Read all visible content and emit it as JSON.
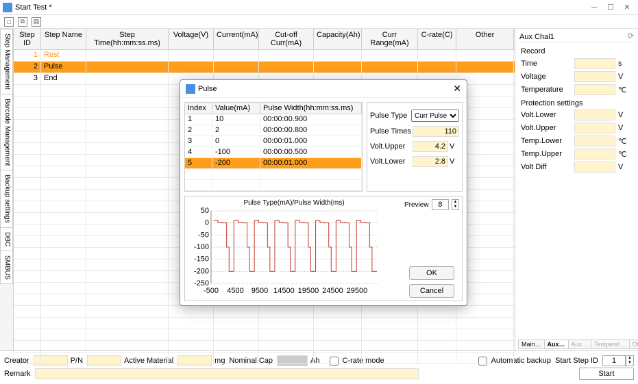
{
  "window": {
    "title": "Start Test *"
  },
  "sideTabs": [
    "Step Management",
    "Barcode Management",
    "Backup settings",
    "DBC",
    "SMBUS"
  ],
  "grid": {
    "headers": [
      "Step ID",
      "Step Name",
      "Step Time(hh:mm:ss.ms)",
      "Voltage(V)",
      "Current(mA)",
      "Cut-off Curr(mA)",
      "Capacity(Ah)",
      "Curr Range(mA)",
      "C-rate(C)",
      "Other"
    ],
    "rows": [
      {
        "id": "1",
        "name": "Rest",
        "class": "rest"
      },
      {
        "id": "2",
        "name": "Pulse",
        "class": "sel"
      },
      {
        "id": "3",
        "name": "End",
        "class": ""
      }
    ]
  },
  "aux": {
    "title": "Aux Chal1",
    "sections": {
      "record_title": "Record",
      "record": [
        {
          "lbl": "Time",
          "unit": "s"
        },
        {
          "lbl": "Voltage",
          "unit": "V"
        },
        {
          "lbl": "Temperature",
          "unit": "℃"
        }
      ],
      "prot_title": "Protection settings",
      "prot": [
        {
          "lbl": "Volt.Lower",
          "unit": "V"
        },
        {
          "lbl": "Volt.Upper",
          "unit": "V"
        },
        {
          "lbl": "Temp.Lower",
          "unit": "℃"
        },
        {
          "lbl": "Temp.Upper",
          "unit": "℃"
        },
        {
          "lbl": "Volt Diff",
          "unit": "V"
        }
      ]
    },
    "subtabs": [
      "Main…",
      "Aux…",
      "Aux…",
      "Temperat…",
      "Other"
    ]
  },
  "bottom": {
    "labels": {
      "creator": "Creator",
      "pn": "P/N",
      "active": "Active Material",
      "mg": "mg",
      "nominal": "Nominal Cap",
      "ah": "Ah",
      "crate": "C-rate mode",
      "auto": "Automatic backup",
      "startid": "Start Step ID",
      "remark": "Remark",
      "start": "Start"
    },
    "startStepId": "1"
  },
  "modal": {
    "title": "Pulse",
    "tableHeaders": [
      "Index",
      "Value(mA)",
      "Pulse Width(hh:mm:ss.ms)"
    ],
    "tableRows": [
      {
        "idx": "1",
        "val": "10",
        "pw": "00:00:00.900"
      },
      {
        "idx": "2",
        "val": "2",
        "pw": "00:00:00.800"
      },
      {
        "idx": "3",
        "val": "0",
        "pw": "00:00:01.000"
      },
      {
        "idx": "4",
        "val": "-100",
        "pw": "00:00:00.500"
      },
      {
        "idx": "5",
        "val": "-200",
        "pw": "00:00:01.000",
        "sel": true
      }
    ],
    "side": {
      "pulseType_lbl": "Pulse Type",
      "pulseType_val": "Curr Pulse",
      "times_lbl": "Pulse Times",
      "times_val": "110",
      "upper_lbl": "Volt.Upper",
      "upper_val": "4.2",
      "upper_unit": "V",
      "lower_lbl": "Volt.Lower",
      "lower_val": "2.8",
      "lower_unit": "V"
    },
    "chartTitle": "Pulse Type(mA)/Pulse Width(ms)",
    "preview_lbl": "Preview",
    "preview_val": "8",
    "ok": "OK",
    "cancel": "Cancel"
  },
  "chart_data": {
    "type": "line",
    "title": "Pulse Type(mA)/Pulse Width(ms)",
    "xlabel": "",
    "ylabel": "",
    "ylim": [
      -250,
      50
    ],
    "yticks": [
      50,
      0,
      -50,
      -100,
      -150,
      -200,
      -250
    ],
    "xticks": [
      -500,
      4500,
      9500,
      14500,
      19500,
      24500,
      29500
    ],
    "pulse_steps": [
      {
        "value": 10,
        "ms": 900
      },
      {
        "value": 2,
        "ms": 800
      },
      {
        "value": 0,
        "ms": 1000
      },
      {
        "value": -100,
        "ms": 500
      },
      {
        "value": -200,
        "ms": 1000
      }
    ],
    "repeat": 8
  }
}
